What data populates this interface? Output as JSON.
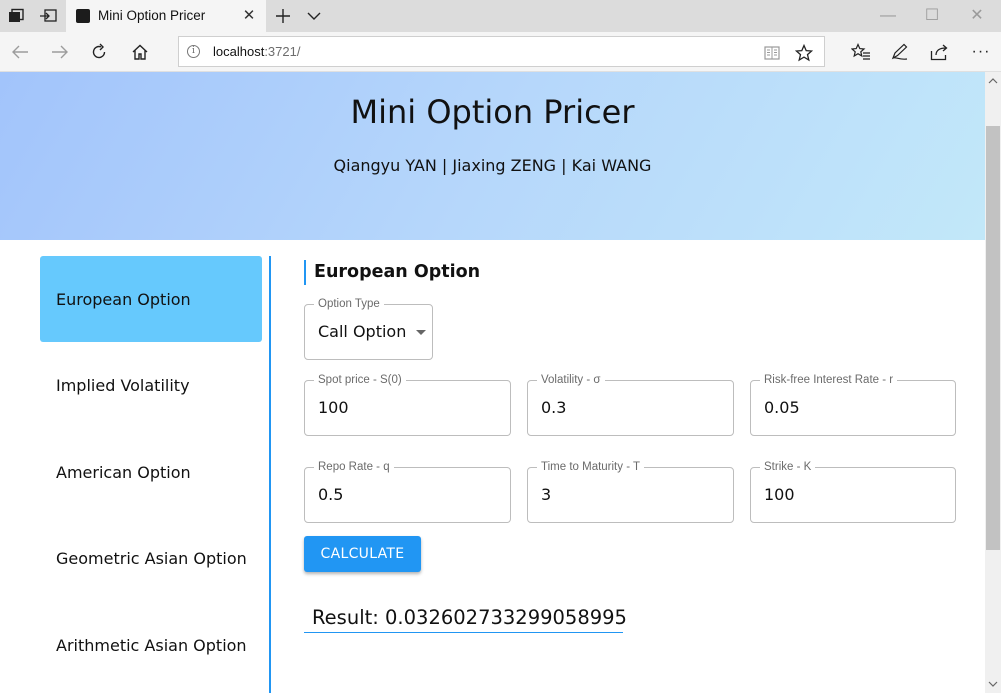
{
  "browser": {
    "tab_title": "Mini Option Pricer",
    "tab_close": "✕",
    "address": {
      "host": "localhost",
      "rest": ":3721/"
    },
    "win_controls": {
      "minimize": "—",
      "maximize": "☐",
      "close": "✕"
    },
    "more": "···"
  },
  "header": {
    "title": "Mini Option Pricer",
    "authors": "Qiangyu YAN | Jiaxing ZENG | Kai WANG"
  },
  "sidebar": {
    "items": [
      {
        "label": "European Option",
        "active": true
      },
      {
        "label": "Implied Volatility",
        "active": false
      },
      {
        "label": "American Option",
        "active": false
      },
      {
        "label": "Geometric Asian Option",
        "active": false
      },
      {
        "label": "Arithmetic Asian Option",
        "active": false
      }
    ]
  },
  "main": {
    "section_title": "European Option",
    "option_type": {
      "label": "Option Type",
      "value": "Call Option"
    },
    "fields": [
      {
        "label": "Spot price - S(0)",
        "value": "100"
      },
      {
        "label": "Volatility - σ",
        "value": "0.3"
      },
      {
        "label": "Risk-free Interest Rate - r",
        "value": "0.05"
      },
      {
        "label": "Repo Rate - q",
        "value": "0.5"
      },
      {
        "label": "Time to Maturity - T",
        "value": "3"
      },
      {
        "label": "Strike - K",
        "value": "100"
      }
    ],
    "calculate_label": "CALCULATE",
    "result": "Result: 0.032602733299058995"
  },
  "colors": {
    "accent": "#2196f3",
    "active_item": "#66c9fd",
    "hero_gradient": [
      "#a2c4fb",
      "#c2e8f9"
    ]
  }
}
